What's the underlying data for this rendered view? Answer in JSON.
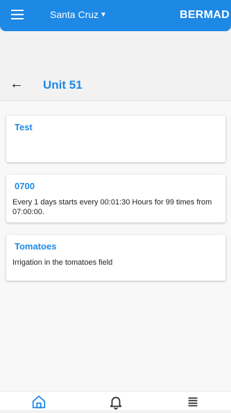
{
  "topbar": {
    "site_name": "Santa Cruz",
    "brand": "BERMAD",
    "menu_icon": "hamburger-icon",
    "caret_icon": "caret-down-icon"
  },
  "header": {
    "back_icon": "arrow-left-icon",
    "title": "Unit 51"
  },
  "programs": [
    {
      "name": "Test",
      "description": ""
    },
    {
      "name": "0700",
      "description": "Every 1 days starts every 00:01:30 Hours for 99 times from 07:00:00."
    },
    {
      "name": "Tomatoes",
      "description": "Irrigation in the tomatoes field"
    }
  ],
  "bottom_nav": {
    "items": [
      "home-icon",
      "bell-icon",
      "list-icon"
    ],
    "active": "home-icon"
  },
  "colors": {
    "accent": "#1e88e5",
    "background": "#f2f2f2"
  }
}
